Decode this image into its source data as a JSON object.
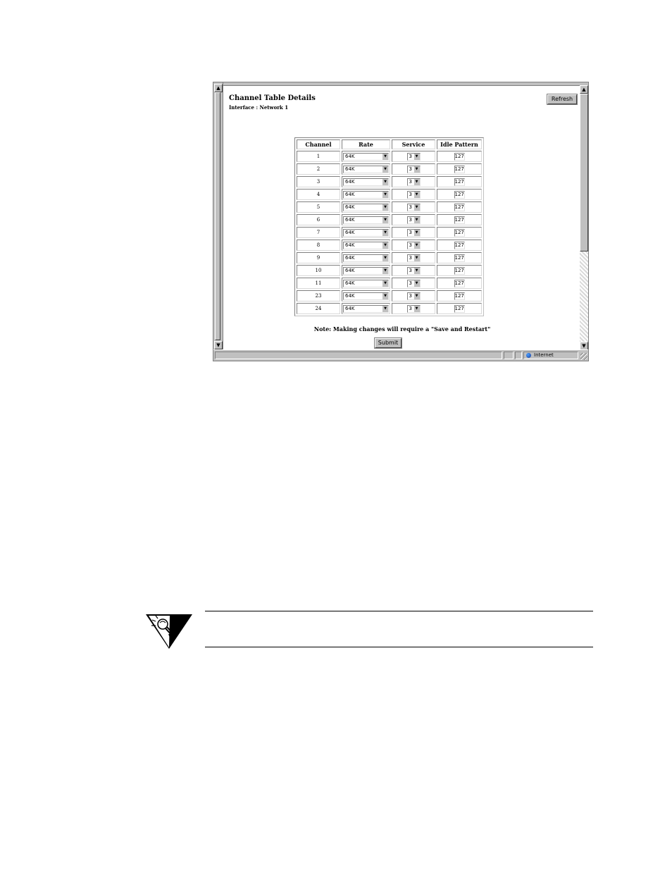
{
  "page": {
    "title": "Channel Table Details",
    "subtitle": "Interface : Network 1",
    "refresh_label": "Refresh",
    "submit_label": "Submit",
    "note": "Note:  Making changes will require a \"Save and Restart\""
  },
  "table": {
    "headers": [
      "Channel",
      "Rate",
      "Service",
      "Idle Pattern"
    ],
    "rows": [
      {
        "channel": "1",
        "rate": "64K",
        "service": "3",
        "idle": "127"
      },
      {
        "channel": "2",
        "rate": "64K",
        "service": "3",
        "idle": "127"
      },
      {
        "channel": "3",
        "rate": "64K",
        "service": "3",
        "idle": "127"
      },
      {
        "channel": "4",
        "rate": "64K",
        "service": "3",
        "idle": "127"
      },
      {
        "channel": "5",
        "rate": "64K",
        "service": "3",
        "idle": "127"
      },
      {
        "channel": "6",
        "rate": "64K",
        "service": "3",
        "idle": "127"
      },
      {
        "channel": "7",
        "rate": "64K",
        "service": "3",
        "idle": "127"
      },
      {
        "channel": "8",
        "rate": "64K",
        "service": "3",
        "idle": "127"
      },
      {
        "channel": "9",
        "rate": "64K",
        "service": "3",
        "idle": "127"
      },
      {
        "channel": "10",
        "rate": "64K",
        "service": "3",
        "idle": "127"
      },
      {
        "channel": "11",
        "rate": "64K",
        "service": "3",
        "idle": "127"
      },
      {
        "channel": "23",
        "rate": "64K",
        "service": "3",
        "idle": "127"
      },
      {
        "channel": "24",
        "rate": "64K",
        "service": "3",
        "idle": "127"
      }
    ]
  },
  "statusbar": {
    "zone": "Internet",
    "zone_icon": "globe-icon"
  },
  "tip": {
    "icon": "lightbulb-icon"
  }
}
